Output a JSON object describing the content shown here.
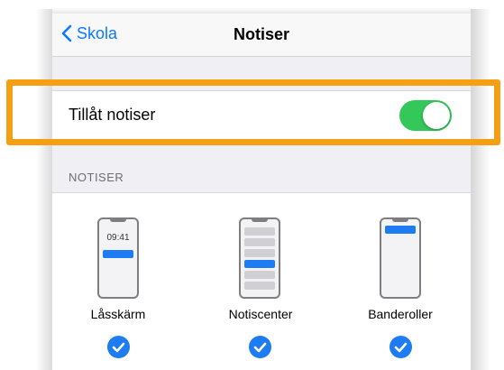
{
  "navbar": {
    "back_label": "Skola",
    "title": "Notiser"
  },
  "allow_notifications": {
    "label": "Tillåt notiser",
    "enabled": true
  },
  "section": {
    "header": "NOTISER"
  },
  "alert_styles": {
    "lock_screen": {
      "label": "Låsskärm",
      "time": "09:41",
      "selected": true
    },
    "notification_center": {
      "label": "Notiscenter",
      "selected": true
    },
    "banners": {
      "label": "Banderoller",
      "selected": true
    }
  },
  "colors": {
    "accent": "#0a7aff",
    "switch_on": "#34c759",
    "highlight": "#f4a012",
    "check": "#1e7cf2"
  },
  "icons": [
    "chevron-left-icon",
    "checkmark-circle-icon"
  ]
}
